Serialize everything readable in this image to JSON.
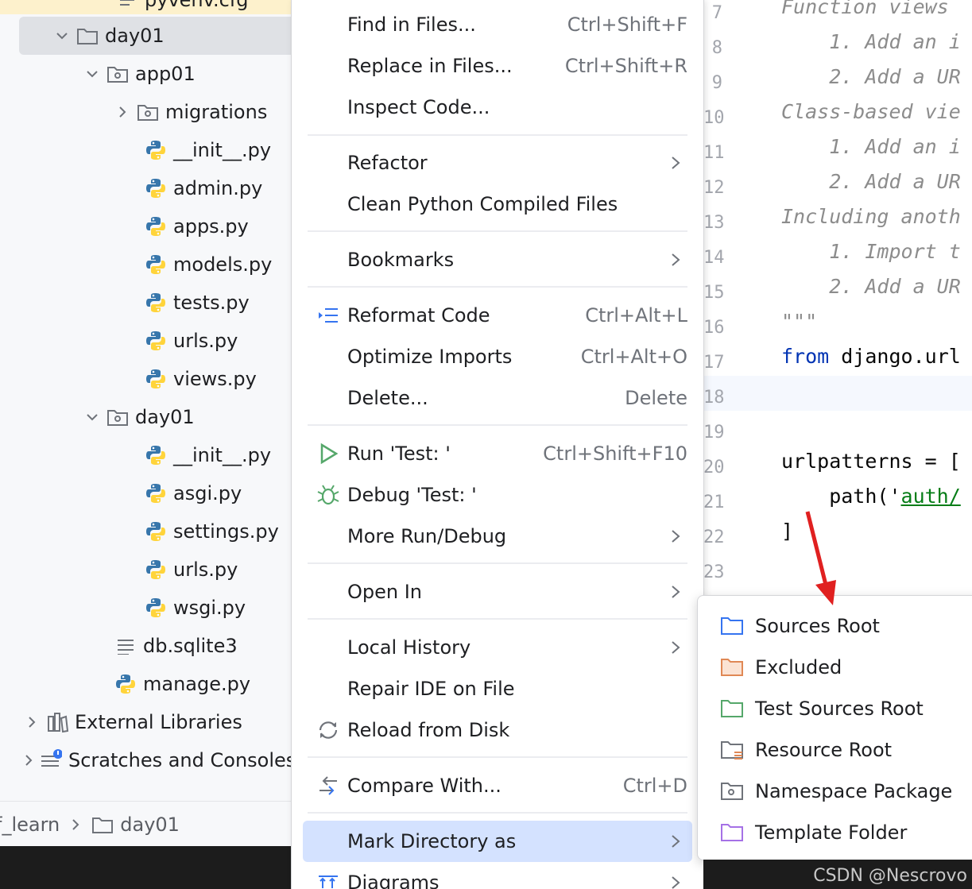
{
  "tree": {
    "top_partial": "pyvenv.cfg",
    "rows": [
      {
        "label": "day01",
        "kind": "folder",
        "expanded": true
      },
      {
        "label": "app01",
        "kind": "package",
        "expanded": true
      },
      {
        "label": "migrations",
        "kind": "package",
        "expanded": false
      },
      {
        "label": "__init__.py",
        "kind": "python"
      },
      {
        "label": "admin.py",
        "kind": "python"
      },
      {
        "label": "apps.py",
        "kind": "python"
      },
      {
        "label": "models.py",
        "kind": "python"
      },
      {
        "label": "tests.py",
        "kind": "python"
      },
      {
        "label": "urls.py",
        "kind": "python"
      },
      {
        "label": "views.py",
        "kind": "python"
      },
      {
        "label": "day01",
        "kind": "package",
        "expanded": true
      },
      {
        "label": "__init__.py",
        "kind": "python"
      },
      {
        "label": "asgi.py",
        "kind": "python"
      },
      {
        "label": "settings.py",
        "kind": "python"
      },
      {
        "label": "urls.py",
        "kind": "python"
      },
      {
        "label": "wsgi.py",
        "kind": "python"
      },
      {
        "label": "db.sqlite3",
        "kind": "text"
      },
      {
        "label": "manage.py",
        "kind": "python"
      },
      {
        "label": "External Libraries",
        "kind": "library",
        "expanded": false
      },
      {
        "label": "Scratches and Consoles",
        "kind": "scratch",
        "expanded": false
      }
    ]
  },
  "breadcrumb": {
    "part1": "f_learn",
    "part2": "day01"
  },
  "menu": {
    "items": [
      {
        "label": "Find in Files...",
        "shortcut": "Ctrl+Shift+F"
      },
      {
        "label": "Replace in Files...",
        "shortcut": "Ctrl+Shift+R"
      },
      {
        "label": "Inspect Code...",
        "shortcut": ""
      },
      {
        "label": "Refactor",
        "shortcut": ""
      },
      {
        "label": "Clean Python Compiled Files",
        "shortcut": ""
      },
      {
        "label": "Bookmarks",
        "shortcut": ""
      },
      {
        "label": "Reformat Code",
        "shortcut": "Ctrl+Alt+L"
      },
      {
        "label": "Optimize Imports",
        "shortcut": "Ctrl+Alt+O"
      },
      {
        "label": "Delete...",
        "shortcut": "Delete"
      },
      {
        "label": "Run 'Test: '",
        "shortcut": "Ctrl+Shift+F10"
      },
      {
        "label": "Debug 'Test: '",
        "shortcut": ""
      },
      {
        "label": "More Run/Debug",
        "shortcut": ""
      },
      {
        "label": "Open In",
        "shortcut": ""
      },
      {
        "label": "Local History",
        "shortcut": ""
      },
      {
        "label": "Repair IDE on File",
        "shortcut": ""
      },
      {
        "label": "Reload from Disk",
        "shortcut": ""
      },
      {
        "label": "Compare With...",
        "shortcut": "Ctrl+D"
      },
      {
        "label": "Mark Directory as",
        "shortcut": ""
      },
      {
        "label": "Diagrams",
        "shortcut": ""
      }
    ]
  },
  "submenu": {
    "items": [
      {
        "label": "Sources Root",
        "color": "#3574f0"
      },
      {
        "label": "Excluded",
        "color": "#e08855"
      },
      {
        "label": "Test Sources Root",
        "color": "#55a76a"
      },
      {
        "label": "Resource Root",
        "color": "#6f737a"
      },
      {
        "label": "Namespace Package",
        "color": "#6f737a"
      },
      {
        "label": "Template Folder",
        "color": "#a571e6"
      }
    ]
  },
  "editor": {
    "gutter": [
      "7",
      "8",
      "9",
      "10",
      "11",
      "12",
      "13",
      "14",
      "15",
      "16",
      "17",
      "18",
      "19",
      "20",
      "21",
      "22",
      "23"
    ],
    "lines": [
      "Function views",
      "    1. Add an i",
      "    2. Add a UR",
      "Class-based vie",
      "    1. Add an i",
      "    2. Add a UR",
      "Including anoth",
      "    1. Import t",
      "    2. Add a UR",
      "\"\"\"",
      "django.url",
      "",
      "",
      "urlpatterns = [",
      "    path('",
      "]"
    ],
    "from_kw": "from",
    "path_str": "auth/"
  },
  "watermark": "CSDN @Nescrovo",
  "colors": {
    "accent": "#3574f0",
    "selection": "#d4e2ff",
    "python_blue": "#3776ab",
    "python_yellow": "#ffd43b"
  }
}
